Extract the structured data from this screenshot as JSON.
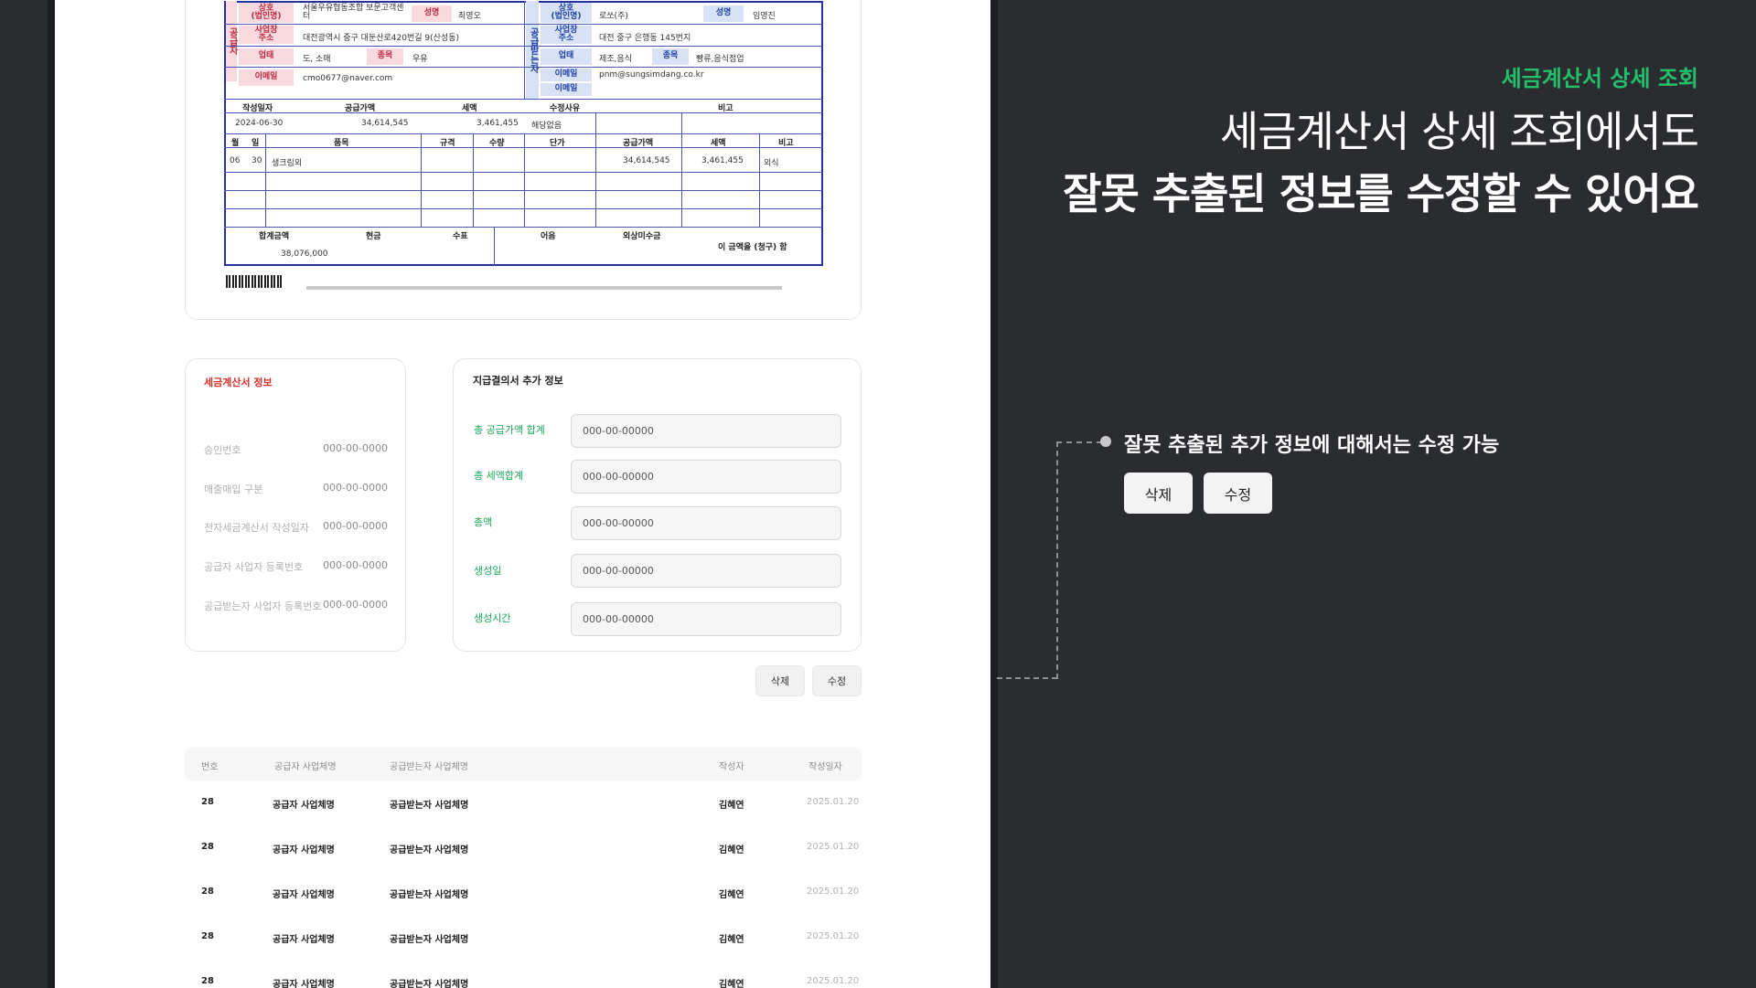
{
  "invoice_scan": {
    "supplier": {
      "side_label": "공급자",
      "company_label": "상호\n(법인명)",
      "company": "서울우유협동조합 보문고객센터",
      "ceo_label": "성명",
      "ceo": "최영오",
      "address_label": "사업장\n주소",
      "address": "대전광역시 중구 대둔산로420번길 9(산성동)",
      "business_label": "업태",
      "business": "도, 소매",
      "item_label": "종목",
      "item": "우유",
      "email_label": "이메일",
      "email": "cmo0677@naver.com"
    },
    "buyer": {
      "side_label": "공급받는자",
      "company_label": "상호\n(법인명)",
      "company": "로쏘(주)",
      "ceo_label": "성명",
      "ceo": "임영진",
      "address_label": "사업장\n주소",
      "address": "대전 중구 은행동 145번지",
      "business_label": "업태",
      "business": "제조,음식",
      "item_label": "종목",
      "item": "빵류,음식점업",
      "email_label": "이메일",
      "email": "pnm@sungsimdang.co.kr",
      "email2_label": "이메일"
    },
    "summary_headers": [
      "작성일자",
      "공급가액",
      "세액",
      "수정사유",
      "비고"
    ],
    "summary_values": [
      "2024-06-30",
      "34,614,545",
      "3,461,455",
      "해당없음",
      ""
    ],
    "item_headers": [
      "월",
      "일",
      "품목",
      "규격",
      "수량",
      "단가",
      "공급가액",
      "세액",
      "비고"
    ],
    "item_row": [
      "06",
      "30",
      "생크림외",
      "",
      "",
      "",
      "34,614,545",
      "3,461,455",
      "외식"
    ],
    "total_headers": [
      "합계금액",
      "현금",
      "수표",
      "어음",
      "외상미수금"
    ],
    "total_value": "38,076,000",
    "claim_text": "이 금액을 (청구) 함"
  },
  "tax_invoice_info": {
    "title": "세금계산서 정보",
    "rows": [
      {
        "label": "승인번호",
        "value": "000-00-0000"
      },
      {
        "label": "매출매입 구분",
        "value": "000-00-0000"
      },
      {
        "label": "전자세금계산서 작성일자",
        "value": "000-00-0000"
      },
      {
        "label": "공급자 사업자 등록번호",
        "value": "000-00-0000"
      },
      {
        "label": "공급받는자 사업자 등록번호",
        "value": "000-00-0000"
      }
    ]
  },
  "payment_extra_info": {
    "title": "지급결의서 추가 정보",
    "fields": [
      {
        "label": "총 공급가액 합계",
        "value": "000-00-00000"
      },
      {
        "label": "총 세액합계",
        "value": "000-00-00000"
      },
      {
        "label": "총액",
        "value": "000-00-00000"
      },
      {
        "label": "생성일",
        "value": "000-00-00000"
      },
      {
        "label": "생성시간",
        "value": "000-00-00000"
      }
    ]
  },
  "actions": {
    "delete_label": "삭제",
    "edit_label": "수정"
  },
  "list_table": {
    "headers": [
      "번호",
      "공급자 사업체명",
      "공급받는자 사업체명",
      "작성자",
      "작성일자"
    ],
    "rows": [
      {
        "no": "28",
        "supplier": "공급자 사업체명",
        "buyer": "공급받는자 사업체명",
        "writer": "김혜연",
        "date": "2025.01.20"
      },
      {
        "no": "28",
        "supplier": "공급자 사업체명",
        "buyer": "공급받는자 사업체명",
        "writer": "김혜연",
        "date": "2025.01.20"
      },
      {
        "no": "28",
        "supplier": "공급자 사업체명",
        "buyer": "공급받는자 사업체명",
        "writer": "김혜연",
        "date": "2025.01.20"
      },
      {
        "no": "28",
        "supplier": "공급자 사업체명",
        "buyer": "공급받는자 사업체명",
        "writer": "김혜연",
        "date": "2025.01.20"
      },
      {
        "no": "28",
        "supplier": "공급자 사업체명",
        "buyer": "공급받는자 사업체명",
        "writer": "김혜연",
        "date": "2025.01.20"
      }
    ]
  },
  "promo": {
    "eyebrow": "세금계산서 상세 조회",
    "headline_line1": "세금계산서 상세 조회에서도",
    "headline_line2": "잘못 추출된 정보를 수정할 수 있어요",
    "callout": "잘못 추출된 추가 정보에 대해서는 수정 가능",
    "accent_color": "#22c06a"
  }
}
